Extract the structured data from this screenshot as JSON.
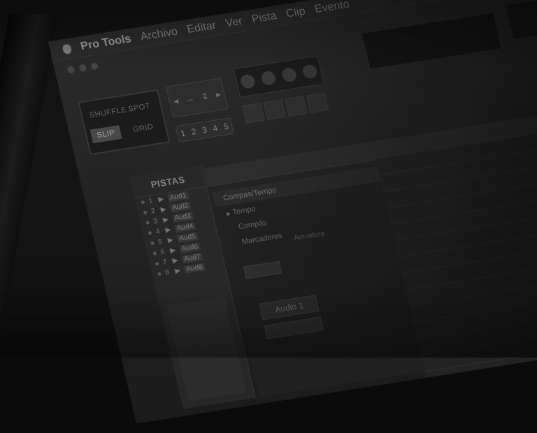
{
  "menubar": {
    "app_name": "Pro Tools",
    "menus": [
      "Archivo",
      "Editar",
      "Ver",
      "Pista",
      "Clip",
      "Evento"
    ]
  },
  "edit_modes": {
    "shuffle": "SHUFFLE",
    "spot": "SPOT",
    "slip": "SLIP",
    "grid": "GRID",
    "active": "SLIP"
  },
  "zoom_presets": [
    "1",
    "2",
    "3",
    "4",
    "5"
  ],
  "tracks": {
    "header": "PISTAS",
    "items": [
      {
        "num": "1",
        "name": "Aud1"
      },
      {
        "num": "2",
        "name": "Aud2"
      },
      {
        "num": "3",
        "name": "Aud3"
      },
      {
        "num": "4",
        "name": "Aud4"
      },
      {
        "num": "5",
        "name": "Aud5"
      },
      {
        "num": "6",
        "name": "Aud6"
      },
      {
        "num": "7",
        "name": "Aud7"
      },
      {
        "num": "8",
        "name": "Aud8"
      }
    ]
  },
  "rulers": {
    "title": "Compas/Tempo",
    "tempo": "Tempo",
    "compas": "Compás",
    "marcadores": "Marcadores",
    "key_signature": "Armadura"
  },
  "track_field": {
    "name": "Audio 1"
  },
  "colors": {
    "background": "#0b0b0b",
    "panel": "#2a2a2a",
    "text": "#8e8e8e"
  }
}
